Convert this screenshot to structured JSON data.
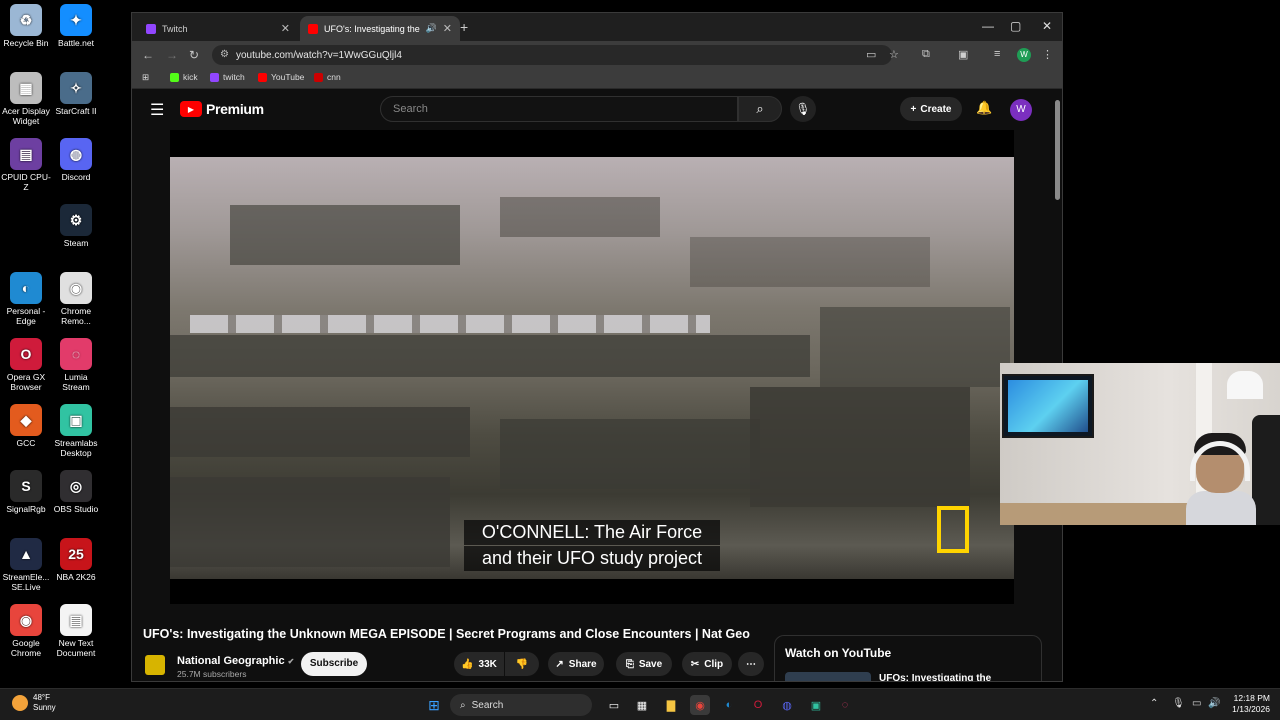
{
  "desktop": {
    "icons": [
      {
        "label": "Recycle Bin",
        "icon": "recycle-bin-icon",
        "color": "#9bb7d4"
      },
      {
        "label": "Battle.net",
        "icon": "battlenet-icon",
        "color": "#148eff"
      },
      {
        "label": "Acer Display Widget",
        "icon": "acer-display-widget-icon",
        "color": "#bdbdbd"
      },
      {
        "label": "StarCraft II",
        "icon": "starcraft-icon",
        "color": "#4a6c8a"
      },
      {
        "label": "CPUID CPU-Z",
        "icon": "cpuz-icon",
        "color": "#6d3fa1"
      },
      {
        "label": "Discord",
        "icon": "discord-icon",
        "color": "#5865f2"
      },
      {
        "label": "Steam",
        "icon": "steam-icon",
        "color": "#1b2838"
      },
      {
        "label": "Personal - Edge",
        "icon": "edge-icon",
        "color": "#1f8ad2"
      },
      {
        "label": "Chrome Remo...",
        "icon": "chrome-remote-icon",
        "color": "#e0e0e0"
      },
      {
        "label": "Opera GX Browser",
        "icon": "opera-gx-icon",
        "color": "#cf1b3b"
      },
      {
        "label": "Lumia Stream",
        "icon": "lumia-stream-icon",
        "color": "#e23b6a"
      },
      {
        "label": "GCC",
        "icon": "gcc-icon",
        "color": "#e35b1e"
      },
      {
        "label": "Streamlabs Desktop",
        "icon": "streamlabs-icon",
        "color": "#31c3a2"
      },
      {
        "label": "SignalRgb",
        "icon": "signalrgb-icon",
        "color": "#2a2a2a"
      },
      {
        "label": "OBS Studio",
        "icon": "obs-icon",
        "color": "#302e31"
      },
      {
        "label": "StreamEle... SE.Live",
        "icon": "streamelements-icon",
        "color": "#202a44"
      },
      {
        "label": "NBA 2K26",
        "icon": "nba2k-icon",
        "color": "#c7141a"
      },
      {
        "label": "Google Chrome",
        "icon": "chrome-icon",
        "color": "#e8453c"
      },
      {
        "label": "New Text Document",
        "icon": "text-document-icon",
        "color": "#f4f4f4"
      }
    ]
  },
  "browser": {
    "tabs": [
      {
        "title": "Twitch",
        "icon": "twitch-icon",
        "color": "#9146ff",
        "active": false
      },
      {
        "title": "UFO's: Investigating the Un",
        "icon": "youtube-icon",
        "color": "#ff0000",
        "active": true
      }
    ],
    "new_tab": "+",
    "url": "youtube.com/watch?v=1WwGGuQljl4",
    "bookmarks": [
      {
        "label": "kick",
        "icon": "kick-icon",
        "color": "#53fc18"
      },
      {
        "label": "twitch",
        "icon": "twitch-icon",
        "color": "#9146ff"
      },
      {
        "label": "YouTube",
        "icon": "youtube-icon",
        "color": "#ff0000"
      },
      {
        "label": "cnn",
        "icon": "cnn-icon",
        "color": "#cc0000"
      }
    ],
    "profile_initial": "W"
  },
  "youtube": {
    "logo_text": "Premium",
    "search_placeholder": "Search",
    "create_label": "Create",
    "avatar_initial": "W",
    "caption_line1": "O'CONNELL: The Air Force",
    "caption_line2": "and their UFO study project",
    "video_title": "UFO's: Investigating the Unknown MEGA EPISODE | Secret Programs and Close Encounters | Nat Geo",
    "channel_name": "National Geographic",
    "subscribers": "25.7M subscribers",
    "subscribe_label": "Subscribe",
    "like_count": "33K",
    "share_label": "Share",
    "save_label": "Save",
    "clip_label": "Clip",
    "more_label": "⋯",
    "watch_panel_title": "Watch on YouTube",
    "watch_panel_item": "UFOs: Investigating the"
  },
  "taskbar": {
    "weather_temp": "48°F",
    "weather_desc": "Sunny",
    "search_label": "Search",
    "time": "12:18 PM",
    "date": "1/13/2026"
  }
}
